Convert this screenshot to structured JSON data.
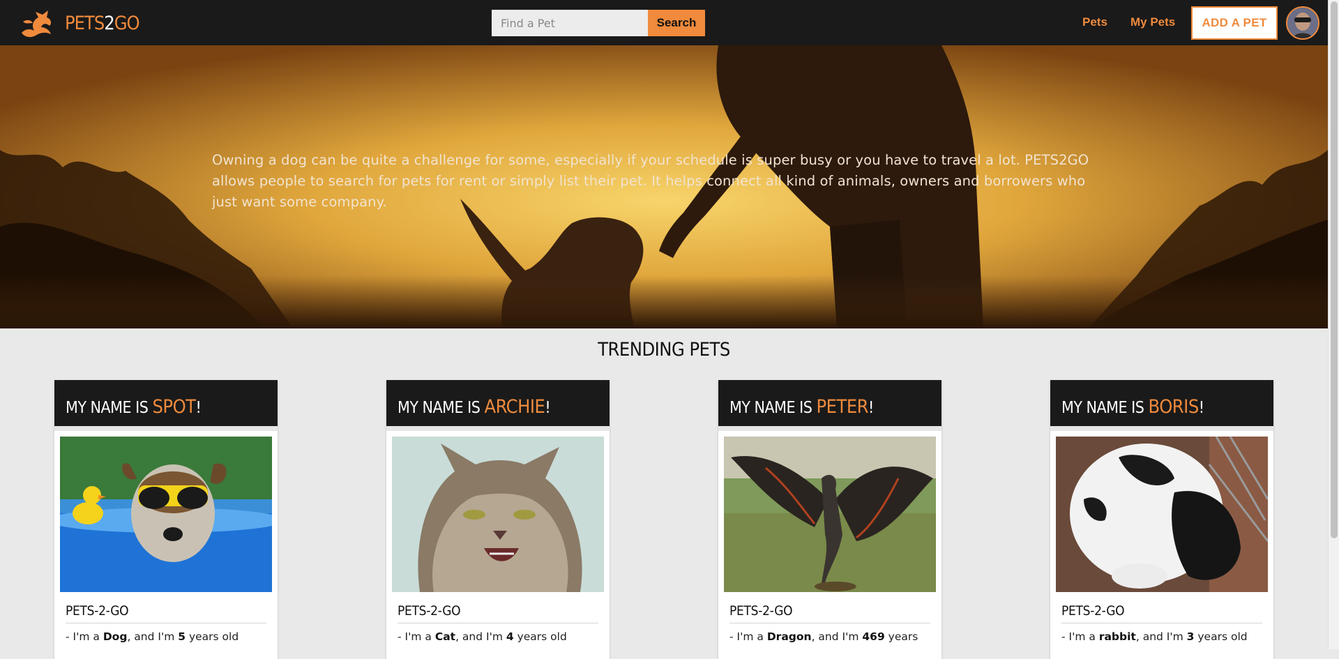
{
  "colors": {
    "accent": "#f08a3c",
    "header_bg": "#1a1a1a",
    "page_bg": "#e9e9e9"
  },
  "header": {
    "brand_left": "PETS",
    "brand_mid": "2",
    "brand_right": "GO",
    "logo_icon": "dragon-logo-icon",
    "search_placeholder": "Find a Pet",
    "search_value": "",
    "search_button": "Search",
    "nav": {
      "pets": "Pets",
      "my_pets": "My Pets",
      "add_pet": "ADD A PET"
    },
    "avatar_icon": "user-avatar-icon"
  },
  "hero": {
    "text": "Owning a dog can be quite a challenge for some, especially if your schedule is super busy or you have to travel a lot. PETS2GO allows people to search for pets for rent or simply list their pet. It helps connect all kind of animals, owners and borrowers who just want some company."
  },
  "trending": {
    "title": "TRENDING PETS",
    "name_prefix": "MY NAME IS ",
    "name_suffix": "!",
    "cards": [
      {
        "name": "SPOT",
        "brand": "PETS-2-GO",
        "desc_prefix": "- I'm a ",
        "species": "Dog",
        "desc_mid": ", and I'm ",
        "age": "5",
        "desc_suffix": " years old",
        "image": "dog-with-sunglasses-photo"
      },
      {
        "name": "ARCHIE",
        "brand": "PETS-2-GO",
        "desc_prefix": "- I'm a ",
        "species": "Cat",
        "desc_mid": ", and I'm ",
        "age": "4",
        "desc_suffix": " years old",
        "image": "grumpy-cat-photo"
      },
      {
        "name": "PETER",
        "brand": "PETS-2-GO",
        "desc_prefix": "- I'm a ",
        "species": "Dragon",
        "desc_mid": ", and I'm ",
        "age": "469",
        "desc_suffix": " years",
        "image": "dragon-photo"
      },
      {
        "name": "BORIS",
        "brand": "PETS-2-GO",
        "desc_prefix": "- I'm a ",
        "species": "rabbit",
        "desc_mid": ", and I'm ",
        "age": "3",
        "desc_suffix": " years old",
        "image": "black-white-rabbit-photo"
      }
    ]
  }
}
